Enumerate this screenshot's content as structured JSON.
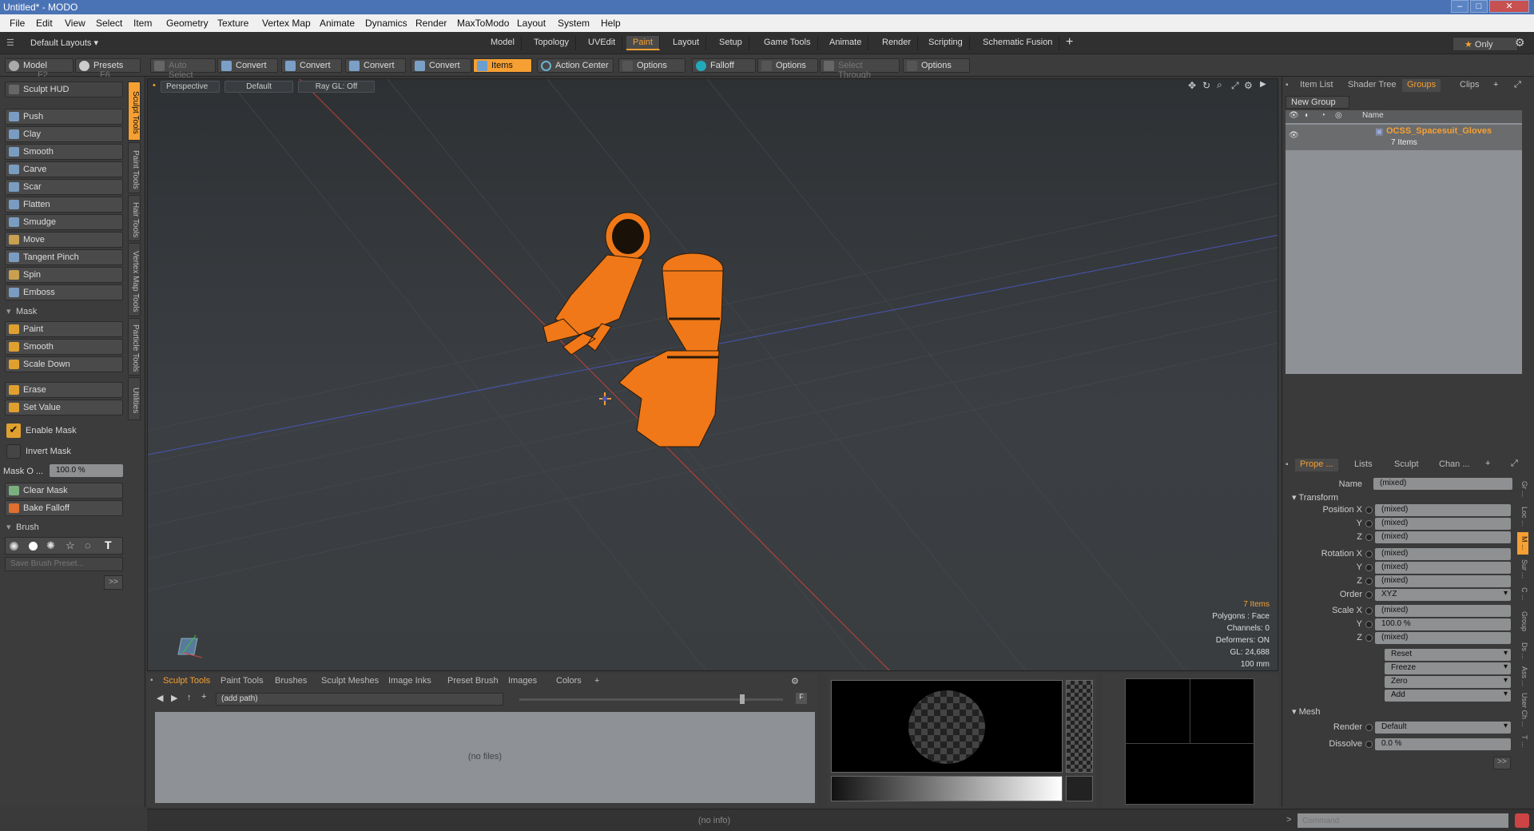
{
  "window": {
    "title": "Untitled* - MODO",
    "min": "–",
    "max": "□",
    "close": "✕"
  },
  "menu": [
    "File",
    "Edit",
    "View",
    "Select",
    "Item",
    "Geometry",
    "Texture",
    "Vertex Map",
    "Animate",
    "Dynamics",
    "Render",
    "MaxToModo",
    "Layout",
    "System",
    "Help"
  ],
  "layouts": {
    "label": "Default Layouts ▾",
    "only": "Only"
  },
  "tabs": [
    "Model",
    "Topology",
    "UVEdit",
    "Paint",
    "Layout",
    "Setup",
    "Game Tools",
    "Animate",
    "Render",
    "Scripting",
    "Schematic Fusion"
  ],
  "active_tab": "Paint",
  "toolbar": {
    "model": "Model",
    "model_key": "F2",
    "presets": "Presets",
    "presets_key": "F6",
    "auto_select": "Auto Select",
    "convert1": "Convert",
    "convert2": "Convert",
    "convert3": "Convert",
    "convert4": "Convert",
    "items": "Items",
    "action_center": "Action Center",
    "options1": "Options",
    "falloff": "Falloff",
    "options2": "Options",
    "select_through": "Select Through",
    "options3": "Options"
  },
  "sculpt": {
    "hud": "Sculpt HUD",
    "tools": [
      "Push",
      "Clay",
      "Smooth",
      "Carve",
      "Scar",
      "Flatten",
      "Smudge",
      "Move",
      "Tangent Pinch",
      "Spin",
      "Emboss"
    ],
    "mask_header": "Mask",
    "mask_tools": [
      "Paint",
      "Smooth",
      "Scale Down"
    ],
    "erase": "Erase",
    "set_value": "Set Value",
    "enable_mask": "Enable Mask",
    "invert_mask": "Invert Mask",
    "mask_opacity_label": "Mask O ...",
    "mask_opacity": "100.0 %",
    "clear_mask": "Clear Mask",
    "bake_falloff": "Bake Falloff",
    "brush_header": "Brush",
    "save_brush_preset": "Save Brush Preset...",
    "more": ">>"
  },
  "side_tabs": [
    "Sculpt Tools",
    "Paint Tools",
    "Hair Tools",
    "Vertex Map Tools",
    "Particle Tools",
    "Utilities"
  ],
  "viewport": {
    "view": "Perspective",
    "shading": "Default",
    "raygl": "Ray GL: Off",
    "stats": {
      "items": "7 Items",
      "polygons": "Polygons : Face",
      "channels": "Channels: 0",
      "deformers": "Deformers: ON",
      "gl": "GL: 24,688",
      "scale": "100 mm"
    }
  },
  "bottom": {
    "tabs": [
      "Sculpt Tools",
      "Paint Tools",
      "Brushes",
      "Sculpt Meshes",
      "Image Inks",
      "Preset Brush",
      "Images",
      "Colors"
    ],
    "path": "(add path)",
    "empty": "(no files)"
  },
  "right": {
    "tabs": [
      "Item List",
      "Shader Tree",
      "Groups",
      "Clips"
    ],
    "active_tab": "Groups",
    "new_group": "New Group",
    "col_name": "Name",
    "group_name": "OCSS_Spacesuit_Gloves",
    "group_count": "7 Items"
  },
  "props": {
    "tabs": [
      "Prope ...",
      "Lists",
      "Sculpt",
      "Chan ..."
    ],
    "name_label": "Name",
    "name_value": "(mixed)",
    "transform": "Transform",
    "rows": [
      {
        "label": "Position X",
        "value": "(mixed)"
      },
      {
        "label": "Y",
        "value": "(mixed)"
      },
      {
        "label": "Z",
        "value": "(mixed)"
      },
      {
        "label": "Rotation X",
        "value": "(mixed)"
      },
      {
        "label": "Y",
        "value": "(mixed)"
      },
      {
        "label": "Z",
        "value": "(mixed)"
      }
    ],
    "order_label": "Order",
    "order_value": "XYZ",
    "scale_rows": [
      {
        "label": "Scale X",
        "value": "(mixed)"
      },
      {
        "label": "Y",
        "value": "100.0 %"
      },
      {
        "label": "Z",
        "value": "(mixed)"
      }
    ],
    "actions": [
      "Reset",
      "Freeze",
      "Zero",
      "Add"
    ],
    "mesh": "Mesh",
    "render_label": "Render",
    "render_value": "Default",
    "dissolve_label": "Dissolve",
    "dissolve_value": "0.0 %",
    "more": ">>",
    "vtabs": [
      "Gr ...",
      "Loc ...",
      "M ...",
      "Sur ...",
      "C ...",
      "Group",
      "Ds ...",
      "Ass ...",
      "User Ch ...",
      "T ..."
    ]
  },
  "status": {
    "info": "(no info)",
    "command_placeholder": "Command"
  }
}
